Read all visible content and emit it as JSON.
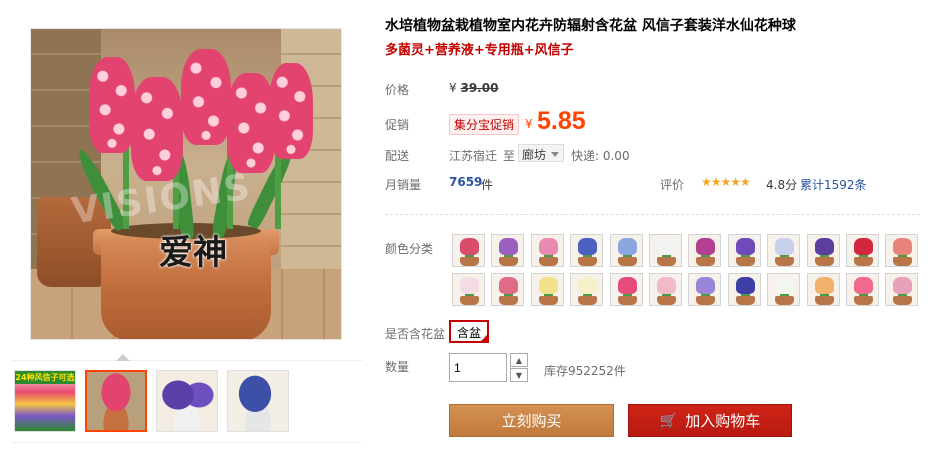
{
  "product": {
    "title": "水培植物盆栽植物室内花卉防辐射含花盆 风信子套装洋水仙花种球",
    "subtitle": "多菌灵+营养液+专用瓶+风信子",
    "image_overlay_text": "爱神",
    "watermark_text": "VISIONS"
  },
  "gallery": {
    "thumbs": [
      {
        "name": "banner-hyacinth-mix",
        "banner": "24种风信子可选",
        "color": "#e84a6f"
      },
      {
        "name": "pink-hyacinth-pot",
        "banner": "",
        "color": "#e2436f"
      },
      {
        "name": "purple-hyacinth-pots",
        "banner": "",
        "color": "#5b3fa8"
      },
      {
        "name": "blue-hyacinth-pot",
        "banner": "",
        "color": "#3e4fa8"
      }
    ]
  },
  "price": {
    "original_label": "价格",
    "original_currency": "¥",
    "original_value": "39.00",
    "promo_label": "促销",
    "promo_tag": "集分宝促销",
    "promo_currency": "¥",
    "promo_value": "5.85"
  },
  "shipping": {
    "label": "配送",
    "from": "江苏宿迁",
    "to_label": "至",
    "to_value": "廊坊",
    "fee": "快递: 0.00"
  },
  "sales": {
    "label": "月销量",
    "count": "7659",
    "unit": "件",
    "rating_label": "评价",
    "stars": "★★★★★",
    "score": "4.8分",
    "reviews": "累计1592条"
  },
  "options": {
    "color_label": "颜色分类",
    "colors": [
      "#d94d6a",
      "#9b5fc0",
      "#e98ab0",
      "#4a61c2",
      "#8aa7e0",
      "#f2f2f2",
      "#b23f8f",
      "#6e4bb8",
      "#c8d0ee",
      "#5a3fa0",
      "#d2283f",
      "#e9837a",
      "#f4dce6",
      "#e06b86",
      "#f3e08a",
      "#f6f0c8",
      "#e54c7c",
      "#f1b9c9",
      "#9a86d6",
      "#3d3fa6",
      "#f5f5f0",
      "#f1b36c",
      "#ef6a8c",
      "#e7a1b8"
    ],
    "pot_label": "是否含花盆",
    "pot_value": "含盆",
    "qty_label": "数量",
    "qty_value": "1",
    "stock": "库存952252件"
  },
  "actions": {
    "buy_now": "立刻购买",
    "add_cart": "加入购物车"
  }
}
